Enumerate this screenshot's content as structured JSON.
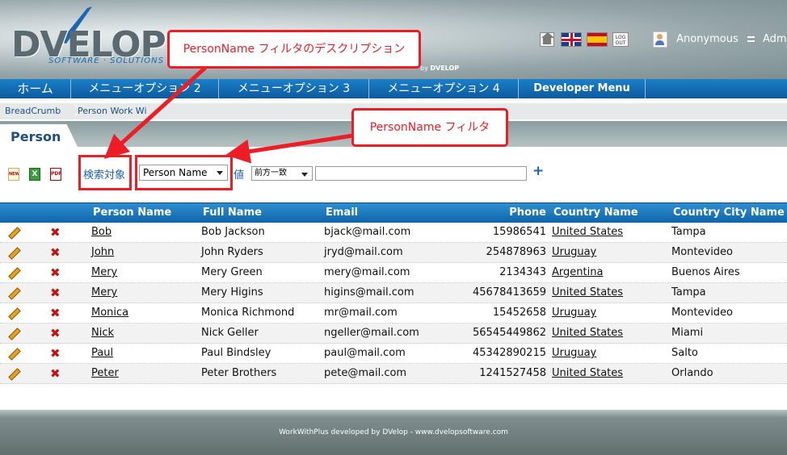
{
  "header": {
    "logo_text": "DVELOP",
    "logo_tagline": "SOFTWARE · SOLUTIONS",
    "byline": "by",
    "byline_brand": "DVELOP",
    "logout_label": "LOG OUT",
    "user_name": "Anonymous",
    "user_admin": "Admini"
  },
  "menu": {
    "items": [
      "ホーム",
      "メニューオプション 2",
      "メニューオプション 3",
      "メニューオプション 4",
      "Developer Menu"
    ]
  },
  "breadcrumb": [
    "BreadCrumb",
    "Person Work Wi"
  ],
  "tab": {
    "title": "Person"
  },
  "toolbar": {
    "new_icon": "NEW",
    "excel_icon": "X",
    "pdf_icon": "PDF",
    "filter_desc": "検索対象",
    "filter_field": "Person Name",
    "value_label": "値",
    "operator": "前方一致",
    "value": "",
    "add_label": "+"
  },
  "annotations": {
    "desc_callout": "PersonName フィルタのデスクリプション",
    "filter_callout": "PersonName フィルタ"
  },
  "grid": {
    "headers": [
      "Person Name",
      "Full Name",
      "Email",
      "Phone",
      "Country Name",
      "Country City Name"
    ],
    "rows": [
      {
        "name": "Bob",
        "full": "Bob Jackson",
        "email": "bjack@mail.com",
        "phone": "15986541",
        "country": "United States",
        "city": "Tampa"
      },
      {
        "name": "John",
        "full": "John Ryders",
        "email": "jryd@mail.com",
        "phone": "254878963",
        "country": "Uruguay",
        "city": "Montevideo"
      },
      {
        "name": "Mery",
        "full": "Mery Green",
        "email": "mery@mail.com",
        "phone": "2134343",
        "country": "Argentina",
        "city": "Buenos Aires"
      },
      {
        "name": "Mery",
        "full": "Mery Higins",
        "email": "higins@mail.com",
        "phone": "45678413659",
        "country": "United States",
        "city": "Tampa"
      },
      {
        "name": "Monica",
        "full": "Monica Richmond",
        "email": "mr@mail.com",
        "phone": "15452658",
        "country": "Uruguay",
        "city": "Montevideo"
      },
      {
        "name": "Nick",
        "full": "Nick Geller",
        "email": "ngeller@mail.com",
        "phone": "56545449862",
        "country": "United States",
        "city": "Miami"
      },
      {
        "name": "Paul",
        "full": "Paul Bindsley",
        "email": "paul@mail.com",
        "phone": "45342890215",
        "country": "Uruguay",
        "city": "Salto"
      },
      {
        "name": "Peter",
        "full": "Peter Brothers",
        "email": "pete@mail.com",
        "phone": "1241527458",
        "country": "United States",
        "city": "Orlando"
      }
    ]
  },
  "footer": {
    "text": "WorkWithPlus developed by DVelop - www.dvelopsoftware.com"
  },
  "colors": {
    "accent": "#1d63b5",
    "menu": "#0d5a9e",
    "annotation": "#ee1c24",
    "delete": "#c81010"
  }
}
